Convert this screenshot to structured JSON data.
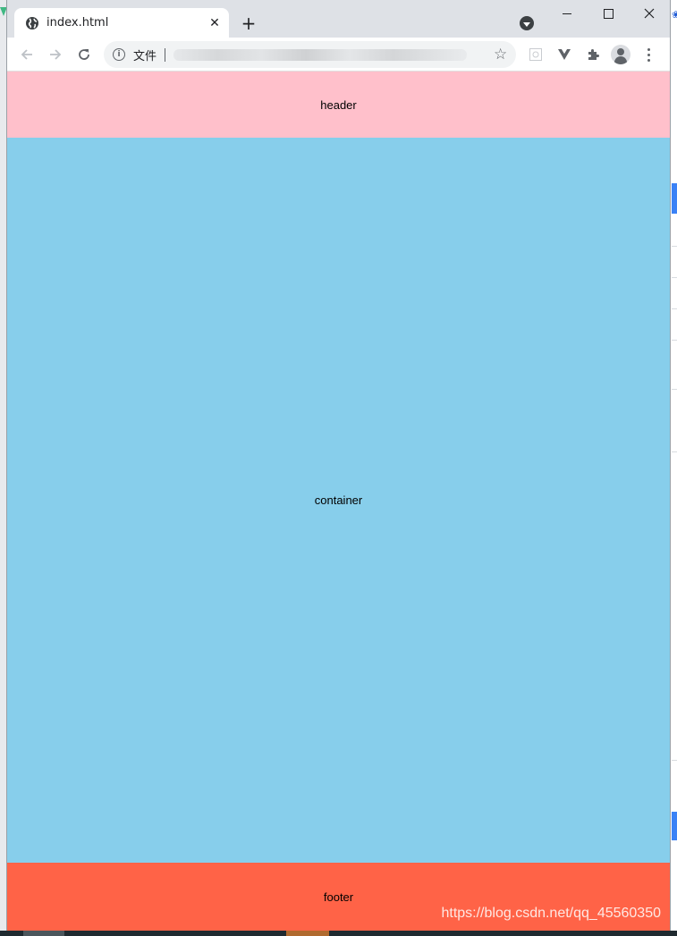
{
  "browser": {
    "tab": {
      "title": "index.html",
      "favicon_icon": "globe-icon",
      "close_glyph": "✕"
    },
    "new_tab_glyph": "+",
    "address_bar": {
      "scheme_label": "文件",
      "url": ""
    },
    "icons": [
      "back-icon",
      "forward-icon",
      "reload-icon",
      "info-icon",
      "star-icon",
      "extension-icon",
      "vue-devtools-icon",
      "puzzle-icon",
      "profile-icon",
      "menu-icon",
      "tab-search-icon",
      "minimize-icon",
      "maximize-icon",
      "close-window-icon"
    ]
  },
  "page": {
    "header": {
      "label": "header",
      "color": "#ffc0cb"
    },
    "container": {
      "label": "container",
      "color": "#87ceeb"
    },
    "footer": {
      "label": "footer",
      "color": "#ff6347"
    }
  },
  "watermark": "https://blog.csdn.net/qq_45560350",
  "colors": {
    "tabstrip": "#dee1e6",
    "omnibox": "#f1f3f4",
    "icon": "#5f6368"
  }
}
